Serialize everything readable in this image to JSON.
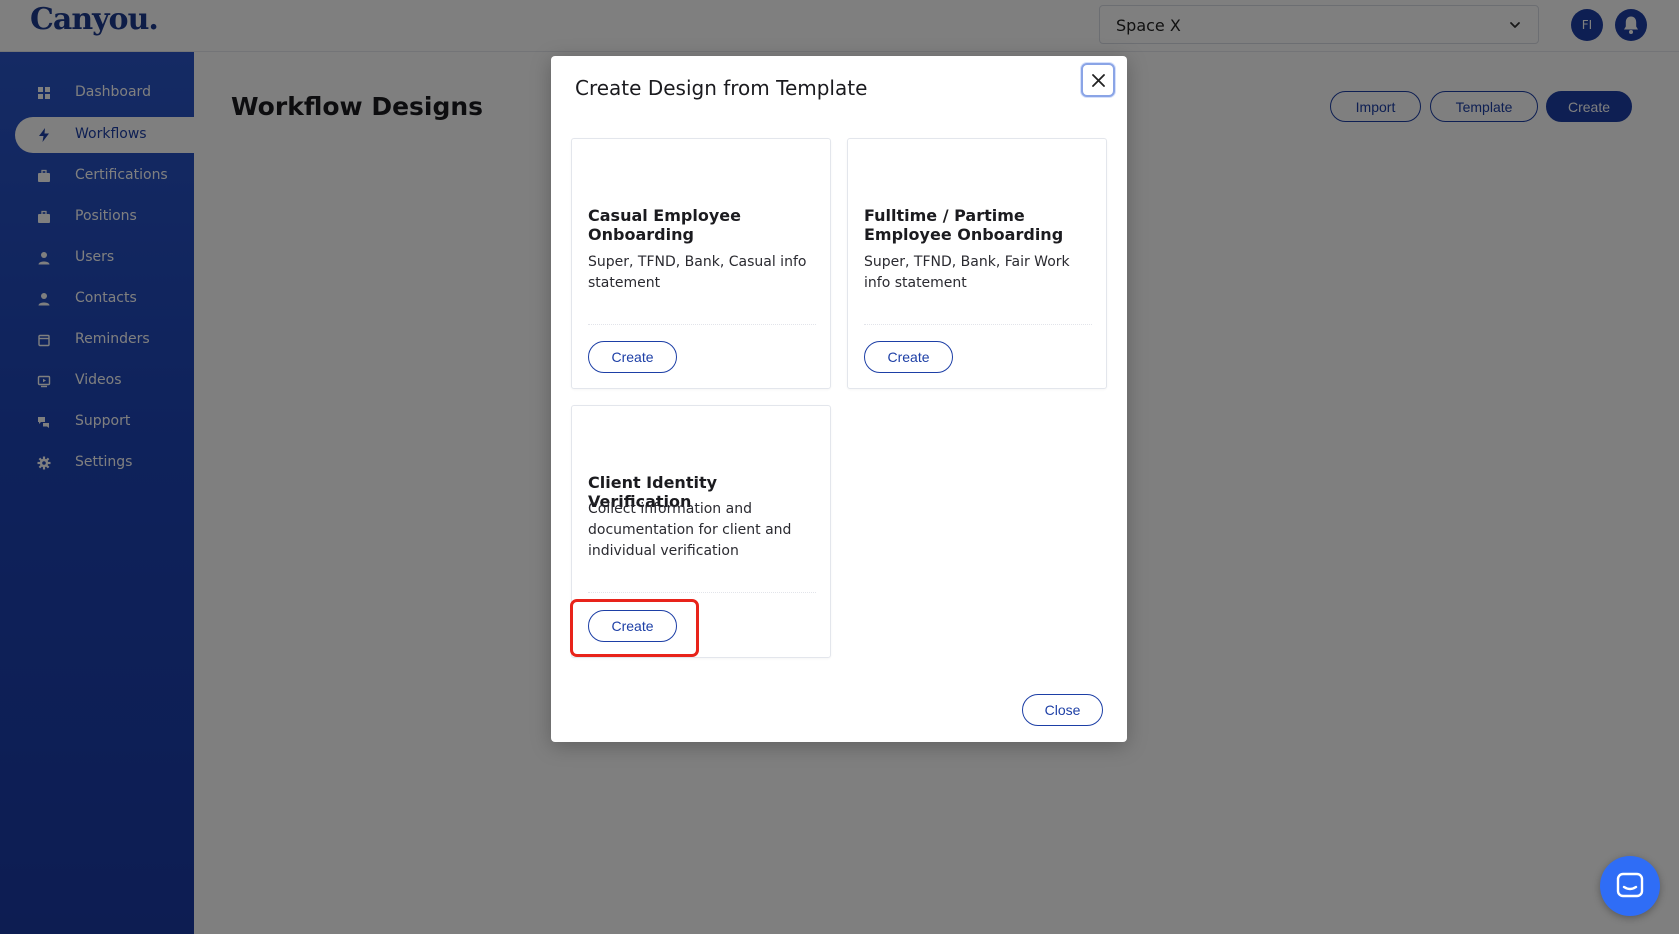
{
  "app": {
    "logo_text": "Canyou.",
    "space_select": {
      "value": "Space X",
      "icon": "chevron-down-icon"
    },
    "avatar_initials": "FI",
    "bell_icon": "bell-icon",
    "brand_color": "#1d3fa6"
  },
  "sidebar": {
    "items": [
      {
        "label": "Dashboard",
        "icon": "dashboard-icon",
        "active": false
      },
      {
        "label": "Workflows",
        "icon": "lightning-icon",
        "active": true
      },
      {
        "label": "Certifications",
        "icon": "briefcase-icon",
        "active": false
      },
      {
        "label": "Positions",
        "icon": "briefcase-icon",
        "active": false
      },
      {
        "label": "Users",
        "icon": "user-icon",
        "active": false
      },
      {
        "label": "Contacts",
        "icon": "user-icon",
        "active": false
      },
      {
        "label": "Reminders",
        "icon": "calendar-icon",
        "active": false
      },
      {
        "label": "Videos",
        "icon": "video-icon",
        "active": false
      },
      {
        "label": "Support",
        "icon": "chat-bubbles-icon",
        "active": false
      },
      {
        "label": "Settings",
        "icon": "gear-icon",
        "active": false
      }
    ]
  },
  "main": {
    "title": "Workflow Designs",
    "buttons": {
      "import": "Import",
      "template": "Template",
      "create": "Create"
    }
  },
  "modal": {
    "title": "Create Design from Template",
    "close_icon": "close-icon",
    "templates": [
      {
        "title": "Casual Employee Onboarding",
        "description": "Super, TFND, Bank, Casual info statement",
        "button": "Create"
      },
      {
        "title": "Fulltime / Partime Employee Onboarding",
        "description": "Super, TFND, Bank, Fair Work info statement",
        "button": "Create"
      },
      {
        "title": "Client Identity Verification",
        "description": "Collect information and documentation for client and individual verification",
        "button": "Create"
      }
    ],
    "close_label": "Close",
    "highlight_color": "#e8231a"
  },
  "chat_launcher_icon": "chat-icon"
}
